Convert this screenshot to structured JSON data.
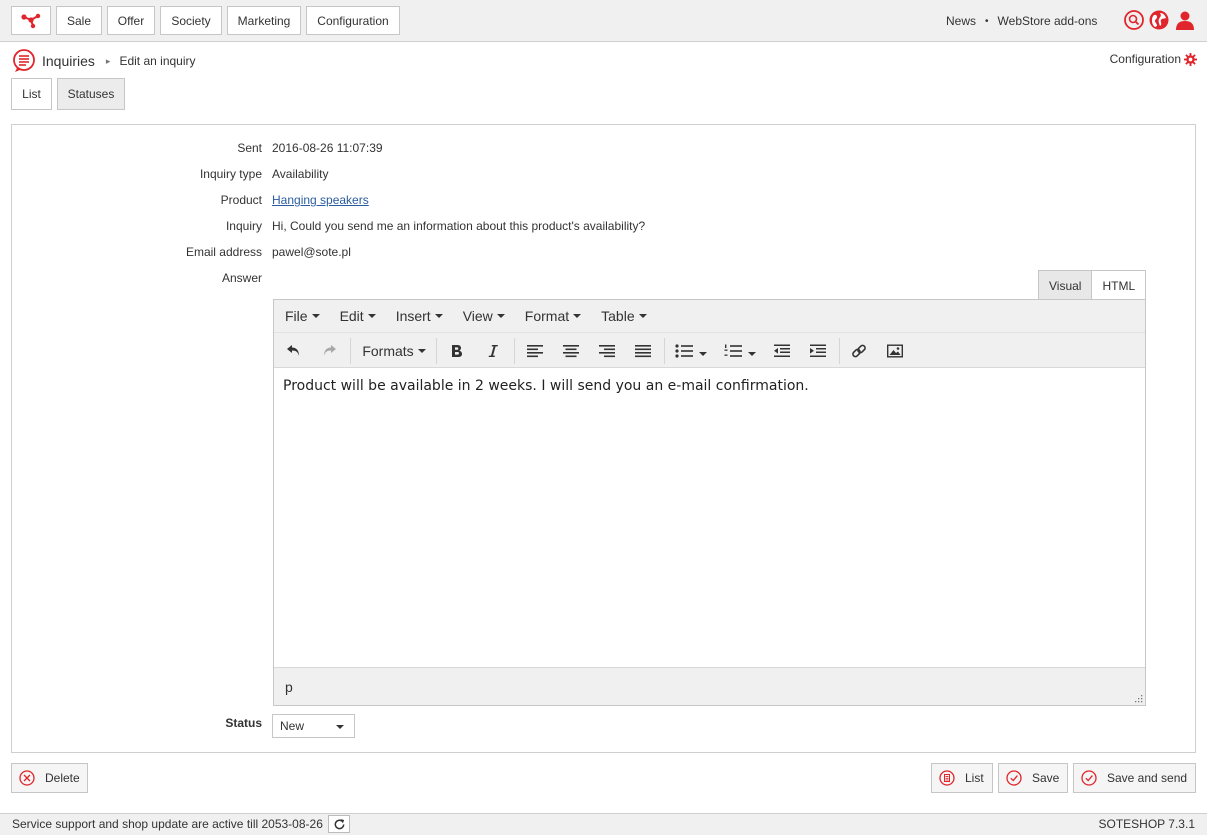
{
  "topnav": {
    "items": [
      "Sale",
      "Offer",
      "Society",
      "Marketing",
      "Configuration"
    ],
    "right_links": [
      "News",
      "WebStore add-ons"
    ],
    "separator": "•",
    "accent": "#e0262c"
  },
  "breadcrumb": {
    "title": "Inquiries",
    "separator": "▸",
    "current": "Edit an inquiry",
    "config_link": "Configuration"
  },
  "tabs": [
    "List",
    "Statuses"
  ],
  "form": {
    "sent": {
      "label": "Sent",
      "value": "2016-08-26 11:07:39"
    },
    "inquiry_type": {
      "label": "Inquiry type",
      "value": "Availability"
    },
    "product": {
      "label": "Product",
      "value": "Hanging speakers"
    },
    "inquiry": {
      "label": "Inquiry",
      "value": "Hi, Could you send me an information about this product's availability?"
    },
    "email": {
      "label": "Email address",
      "value": "pawel@sote.pl"
    },
    "answer": {
      "label": "Answer"
    },
    "status": {
      "label": "Status",
      "value": "New"
    }
  },
  "editor": {
    "mode_tabs": [
      "Visual",
      "HTML"
    ],
    "menu": [
      "File",
      "Edit",
      "Insert",
      "View",
      "Format",
      "Table"
    ],
    "formats_label": "Formats",
    "content": "Product will be available in 2 weeks. I will send you an e-mail confirmation.",
    "path": "p"
  },
  "actions": {
    "delete": "Delete",
    "list": "List",
    "save": "Save",
    "save_send": "Save and send"
  },
  "footer": {
    "support_text": "Service support and shop update are active till 2053-08-26",
    "version": "SOTESHOP 7.3.1"
  }
}
